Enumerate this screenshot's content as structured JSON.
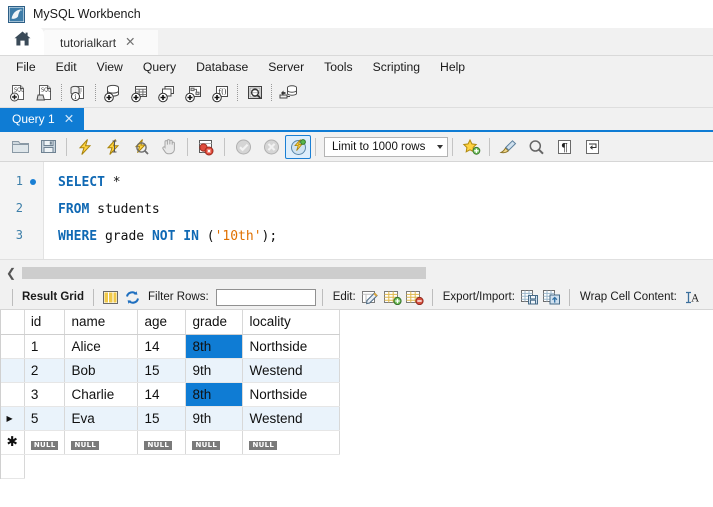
{
  "window": {
    "title": "MySQL Workbench",
    "logo_icon": "workbench-dolphin-icon"
  },
  "tabs": {
    "home_icon": "home-icon",
    "connection_tab": {
      "label": "tutorialkart",
      "close_icon": "close-icon"
    }
  },
  "menubar": {
    "items": [
      {
        "label": "File"
      },
      {
        "label": "Edit"
      },
      {
        "label": "View"
      },
      {
        "label": "Query"
      },
      {
        "label": "Database"
      },
      {
        "label": "Server"
      },
      {
        "label": "Tools"
      },
      {
        "label": "Scripting"
      },
      {
        "label": "Help"
      }
    ]
  },
  "main_toolbar": {
    "buttons": [
      {
        "name": "new-sql-tab-icon",
        "title": "New SQL Tab"
      },
      {
        "name": "open-sql-script-icon",
        "title": "Open SQL Script"
      },
      {
        "name": "connection-info-icon",
        "title": "Connection Info"
      },
      {
        "name": "new-schema-icon",
        "title": "Create New Schema"
      },
      {
        "name": "new-table-icon",
        "title": "Create New Table"
      },
      {
        "name": "new-view-icon",
        "title": "Create New View"
      },
      {
        "name": "new-procedure-icon",
        "title": "Create New Stored Procedure"
      },
      {
        "name": "new-function-icon",
        "title": "Create New Function"
      },
      {
        "name": "search-data-icon",
        "title": "Search Table Data"
      },
      {
        "name": "reconnect-server-icon",
        "title": "Reconnect to DBMS"
      }
    ]
  },
  "query_tab": {
    "label": "Query 1",
    "close_icon": "close-icon"
  },
  "editor_toolbar": {
    "buttons": [
      {
        "name": "open-file-icon",
        "title": "Open a script file"
      },
      {
        "name": "save-script-icon",
        "title": "Save script to file"
      },
      {
        "name": "execute-statement-icon",
        "title": "Execute the statement"
      },
      {
        "name": "execute-current-statement-icon",
        "title": "Execute current statement"
      },
      {
        "name": "explain-query-icon",
        "title": "Explain query"
      },
      {
        "name": "stop-execution-icon",
        "title": "Stop the query"
      },
      {
        "name": "toggle-stop-on-error-icon",
        "title": "Toggle stop on error"
      },
      {
        "name": "commit-icon",
        "title": "Commit"
      },
      {
        "name": "rollback-icon",
        "title": "Rollback"
      },
      {
        "name": "autocommit-icon",
        "title": "Toggle autocommit mode"
      }
    ],
    "limit_select": {
      "value": "Limit to 1000 rows",
      "caret_icon": "chevron-down-icon"
    },
    "right_buttons": [
      {
        "name": "save-snippet-icon",
        "title": "Save snippet"
      },
      {
        "name": "beautify-sql-icon",
        "title": "Beautify/reformat SQL script"
      },
      {
        "name": "find-icon",
        "title": "Find"
      },
      {
        "name": "toggle-invisible-chars-icon",
        "title": "Toggle invisible characters"
      },
      {
        "name": "toggle-wrapping-icon",
        "title": "Toggle wrapping"
      }
    ]
  },
  "editor": {
    "lines": [
      {
        "number": "1",
        "has_breakpoint_dot": true,
        "tokens": [
          {
            "text": "SELECT",
            "type": "kw"
          },
          {
            "text": " ",
            "type": "punct"
          },
          {
            "text": "*",
            "type": "punct"
          }
        ]
      },
      {
        "number": "2",
        "has_breakpoint_dot": false,
        "tokens": [
          {
            "text": "FROM",
            "type": "kw"
          },
          {
            "text": " ",
            "type": "punct"
          },
          {
            "text": "students",
            "type": "ident"
          }
        ]
      },
      {
        "number": "3",
        "has_breakpoint_dot": false,
        "tokens": [
          {
            "text": "WHERE",
            "type": "kw"
          },
          {
            "text": " ",
            "type": "punct"
          },
          {
            "text": "grade",
            "type": "ident"
          },
          {
            "text": " ",
            "type": "punct"
          },
          {
            "text": "NOT",
            "type": "kw"
          },
          {
            "text": " ",
            "type": "punct"
          },
          {
            "text": "IN",
            "type": "kw"
          },
          {
            "text": " (",
            "type": "punct"
          },
          {
            "text": "'10th'",
            "type": "str"
          },
          {
            "text": ");",
            "type": "punct"
          }
        ]
      }
    ],
    "full_text": "SELECT *\nFROM students\nWHERE grade NOT IN ('10th');"
  },
  "splitter": {
    "collapse_icon": "chevron-left-icon"
  },
  "grid_toolbar": {
    "result_grid_label": "Result Grid",
    "form_editor_icon": "form-editor-icon",
    "refresh_icon": "refresh-icon",
    "filter_label": "Filter Rows:",
    "filter_value": "",
    "filter_placeholder": "",
    "edit_label": "Edit:",
    "edit_icons": [
      {
        "name": "edit-row-icon",
        "title": "Edit current row"
      },
      {
        "name": "insert-row-icon",
        "title": "Insert new row"
      },
      {
        "name": "delete-row-icon",
        "title": "Delete selected rows"
      }
    ],
    "export_import_label": "Export/Import:",
    "export_icons": [
      {
        "name": "export-recordset-icon",
        "title": "Export recordset to an external file"
      },
      {
        "name": "import-recordset-icon",
        "title": "Import records from an external file"
      }
    ],
    "wrap_cell_label": "Wrap Cell Content:",
    "wrap_cell_icon": "wrap-cell-icon"
  },
  "result_grid": {
    "columns": [
      "id",
      "name",
      "age",
      "grade",
      "locality"
    ],
    "selected_column": "grade",
    "rows": [
      {
        "id": "1",
        "name": "Alice",
        "age": "14",
        "grade": "8th",
        "locality": "Northside",
        "marker": ""
      },
      {
        "id": "2",
        "name": "Bob",
        "age": "15",
        "grade": "9th",
        "locality": "Westend",
        "marker": ""
      },
      {
        "id": "3",
        "name": "Charlie",
        "age": "14",
        "grade": "8th",
        "locality": "Northside",
        "marker": ""
      },
      {
        "id": "5",
        "name": "Eva",
        "age": "15",
        "grade": "9th",
        "locality": "Westend",
        "marker": "▶"
      }
    ],
    "null_row": {
      "marker": "✱",
      "values": [
        "NULL",
        "NULL",
        "NULL",
        "NULL",
        "NULL"
      ]
    }
  },
  "colors": {
    "accent_blue": "#0f7cd4",
    "selection_blue": "#0f7cd4",
    "alt_row": "#eaf3fb",
    "keyword_blue": "#1069b4",
    "string_orange": "#e07000",
    "chrome_gray": "#f1f1f1"
  }
}
